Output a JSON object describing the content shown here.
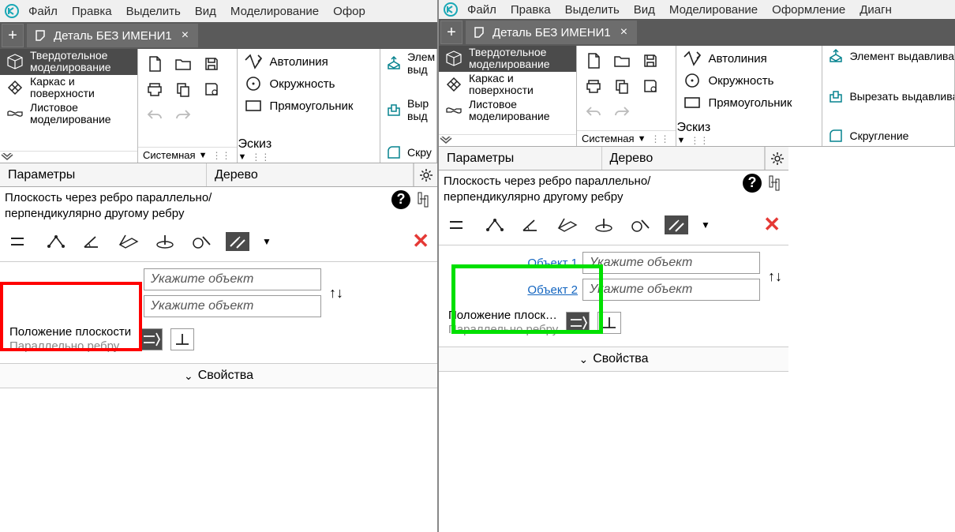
{
  "menu": {
    "file": "Файл",
    "edit": "Правка",
    "select": "Выделить",
    "view": "Вид",
    "model": "Моделирование",
    "format_short": "Офор",
    "format": "Оформление",
    "diag": "Диагн"
  },
  "tab": {
    "title": "Деталь БЕЗ ИМЕНИ1"
  },
  "modes": {
    "solid": "Твердотельное моделирование",
    "frame": "Каркас и поверхности",
    "sheet": "Листовое моделирование"
  },
  "ribbon": {
    "system": "Системная",
    "sketch": "Эскиз",
    "autoline": "Автолиния",
    "circle": "Окружность",
    "rect": "Прямоугольник",
    "extrude_el": "Элемент выдавливания",
    "cut_extrude": "Вырезать выдавливанием",
    "fillet": "Скругление",
    "elem_s": "Элем",
    "vyd_s": "выд",
    "vyr_s": "Выр",
    "vyd2_s": "выд",
    "skr_s": "Скру"
  },
  "panel": {
    "params": "Параметры",
    "tree": "Дерево"
  },
  "cmd": {
    "title_l1": "Плоскость через ребро параллельно/",
    "title_l2": "перпендикулярно другому ребру"
  },
  "fields": {
    "obj1": "Объект 1",
    "obj2": "Объект 2",
    "placeholder": "Укажите объект"
  },
  "pos": {
    "label_full": "Положение плоскости",
    "label_short": "Положение плоск…",
    "para": "Параллельно ребру"
  },
  "props": "Свойства"
}
